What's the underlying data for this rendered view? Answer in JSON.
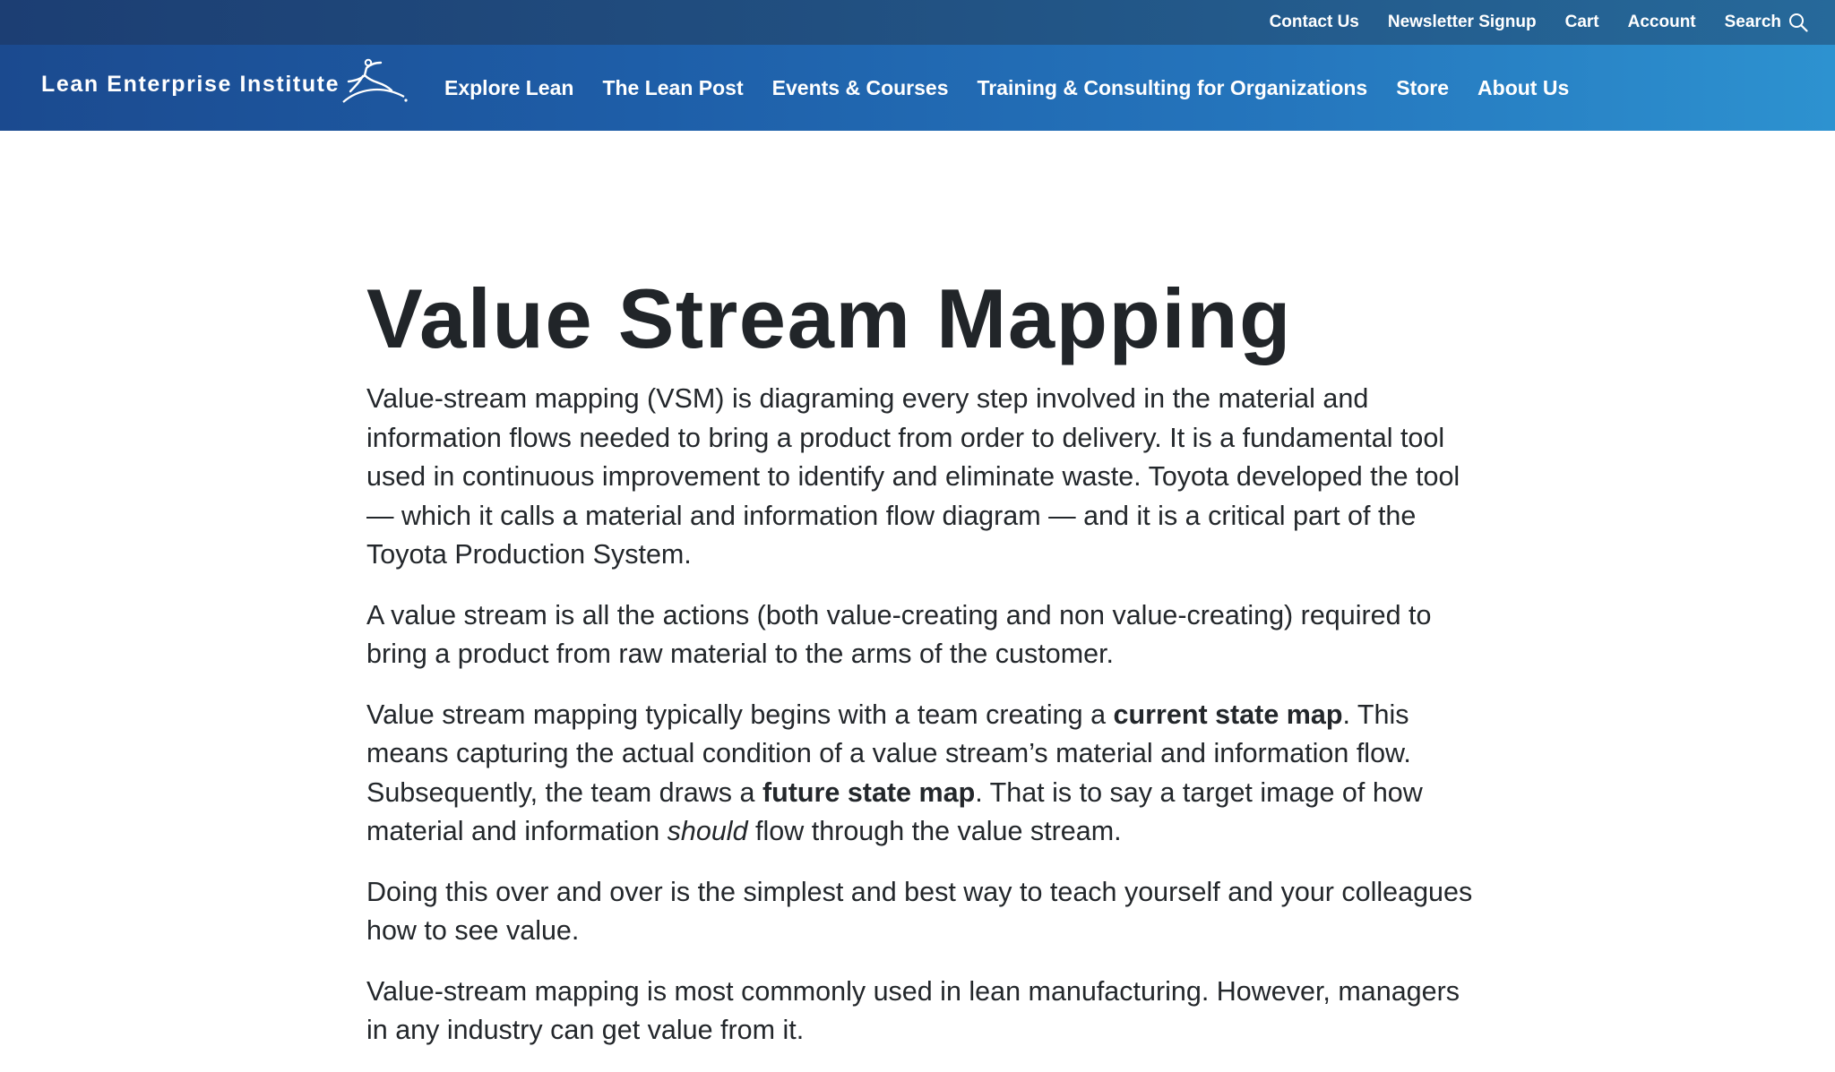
{
  "utility_nav": {
    "items": [
      "Contact Us",
      "Newsletter Signup",
      "Cart",
      "Account"
    ],
    "search_label": "Search"
  },
  "brand": {
    "name": "Lean Enterprise Institute"
  },
  "main_nav": {
    "items": [
      "Explore Lean",
      "The Lean Post",
      "Events & Courses",
      "Training & Consulting for Organizations",
      "Store",
      "About Us"
    ]
  },
  "article": {
    "title": "Value Stream Mapping",
    "p1": "Value-stream mapping (VSM) is diagraming every step involved in the material and information flows needed to bring a product from order to delivery. It is a fundamental tool used in continuous improvement to identify and eliminate waste. Toyota developed the tool — which it calls a material and information flow diagram — and it is a critical part of the Toyota Production System.",
    "p2": "A value stream is all the actions (both value-creating and non value-creating) required to bring a product from raw material to the arms of the customer.",
    "p3": {
      "t1": "Value stream mapping typically begins with a team creating a ",
      "b1": "current state map",
      "t2": ". This means capturing the actual condition of a value stream’s material and information flow. Subsequently, the team draws a ",
      "b2": "future state map",
      "t3": ". That is to say a target image of how material and information ",
      "i1": "should",
      "t4": " flow through the value stream."
    },
    "p4": "Doing this over and over is the simplest and best way to teach yourself and your colleagues how to see value.",
    "p5": "Value-stream mapping is most commonly used in lean manufacturing. However, managers in any industry can get value from it."
  },
  "icons": {
    "search": "search-icon",
    "logo": "leaping-figure-logo-mark"
  },
  "colors": {
    "utility_bar": "#1c3e73",
    "nav_start": "#1b4a8f",
    "nav_end": "#2d92d0",
    "title_text": "#212529",
    "body_text": "#23272b"
  }
}
